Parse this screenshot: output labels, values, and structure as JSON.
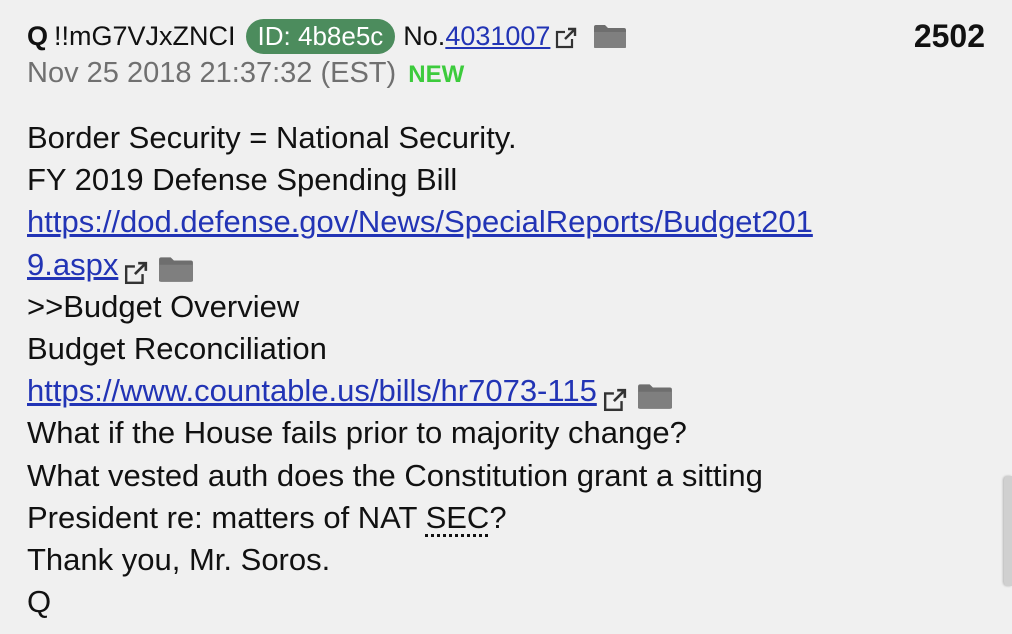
{
  "header": {
    "name": "Q",
    "tripcode": "!!mG7VJxZNCI",
    "id_badge": "ID: 4b8e5c",
    "post_no_label": "No.",
    "post_no": "4031007",
    "post_count": "2502"
  },
  "date": {
    "timestamp": "Nov 25 2018 21:37:32 (EST)",
    "new_label": "NEW"
  },
  "body": {
    "line1": "Border Security = National Security.",
    "line2": "FY 2019 Defense Spending Bill",
    "link1_part1": "https://dod.defense.gov/News/SpecialReports/Budget201",
    "link1_part2": "9.aspx",
    "line4": ">>Budget Overview",
    "line5": "Budget Reconciliation",
    "link2": "https://www.countable.us/bills/hr7073-115",
    "line7": "What if the House fails prior to majority change?",
    "line8": "What vested auth does the Constitution grant a sitting",
    "line9_pre": "President re: matters of NAT ",
    "line9_abbr": "SEC",
    "line9_post": "?",
    "line10": "Thank you, Mr. Soros.",
    "line11": "Q"
  },
  "icons": {
    "external_link": "external-link-icon",
    "folder": "folder-icon"
  },
  "colors": {
    "background": "#f0f0f0",
    "id_badge": "#4c8c5d",
    "link": "#2234b5",
    "new": "#3ccb3c",
    "date": "#707070"
  }
}
